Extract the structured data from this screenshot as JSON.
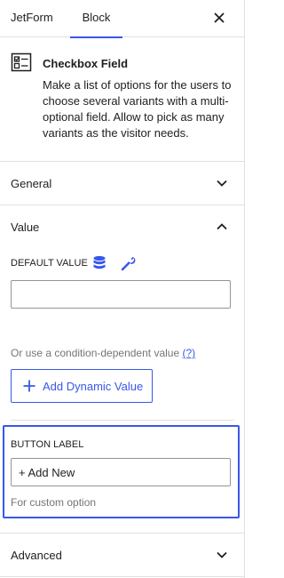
{
  "tabs": {
    "jetform": "JetForm",
    "block": "Block"
  },
  "block": {
    "title": "Checkbox Field",
    "description": "Make a list of options for the users to choose several variants with a multi-optional field. Allow to pick as many variants as the visitor needs."
  },
  "sections": {
    "general": "General",
    "value": "Value",
    "advanced": "Advanced"
  },
  "value_panel": {
    "default_value_label": "DEFAULT VALUE",
    "default_value_input": "",
    "condition_text": "Or use a condition-dependent value",
    "condition_link": "(?)",
    "add_dynamic_label": "Add Dynamic Value",
    "button_label_title": "BUTTON LABEL",
    "button_label_value": "+ Add New",
    "button_label_help": "For custom option"
  },
  "colors": {
    "accent": "#3858e9",
    "border": "#e0e0e0",
    "text": "#1e1e1e",
    "muted": "#757575"
  },
  "icons": [
    "close-icon",
    "checkbox-block-icon",
    "chevron-down-icon",
    "chevron-up-icon",
    "database-icon",
    "wrench-icon",
    "plus-icon"
  ]
}
